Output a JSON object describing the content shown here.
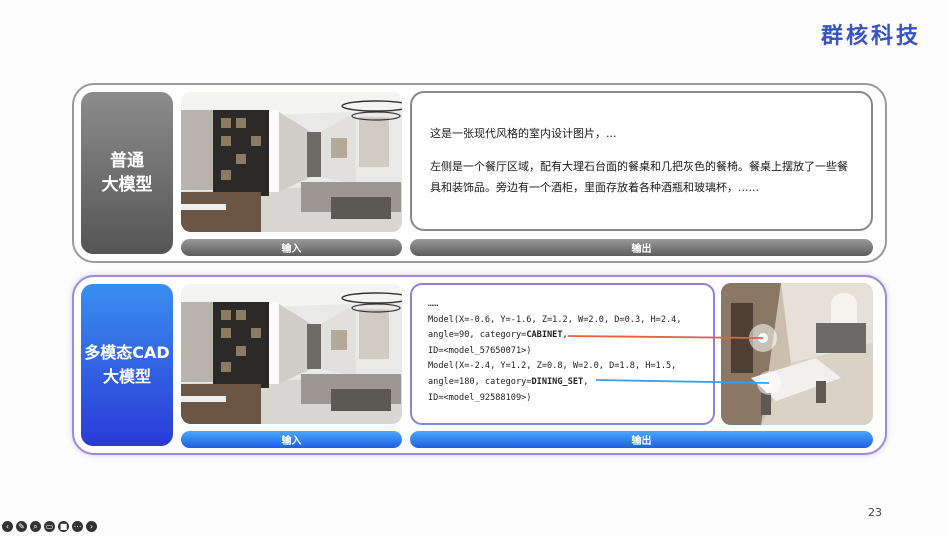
{
  "brand": "群核科技",
  "page_number": "23",
  "row1": {
    "side_label_line1": "普通",
    "side_label_line2": "大模型",
    "input_label": "输入",
    "output_label": "输出",
    "output_text_1": "这是一张现代风格的室内设计图片，...",
    "output_text_2": "左侧是一个餐厅区域，配有大理石台面的餐桌和几把灰色的餐椅。餐桌上摆放了一些餐具和装饰品。旁边有一个酒柜，里面存放着各种酒瓶和玻璃杯，......"
  },
  "row2": {
    "side_label_line1": "多模态CAD",
    "side_label_line2": "大模型",
    "input_label": "输入",
    "output_label": "输出",
    "code_line0": "……",
    "code_line1": "Model(X=-0.6, Y=-1.6, Z=1.2, W=2.0, D=0.3, H=2.4,",
    "code_line2a": "angle=90, category=",
    "code_line2b": "CABINET",
    "code_line2c": ",",
    "code_line3": "ID=<model_57650071>)",
    "code_line4": "Model(X=-2.4, Y=1.2, Z=0.8, W=2.0, D=1.8, H=1.5,",
    "code_line5a": "angle=180, category=",
    "code_line5b": "DINING_SET",
    "code_line5c": ",",
    "code_line6": "ID=<model_92588109>)"
  },
  "colors": {
    "brand": "#3953c6",
    "accent_blue": "#1f5fe0",
    "line_orange": "#e8603c",
    "line_blue": "#3aa0e8"
  }
}
